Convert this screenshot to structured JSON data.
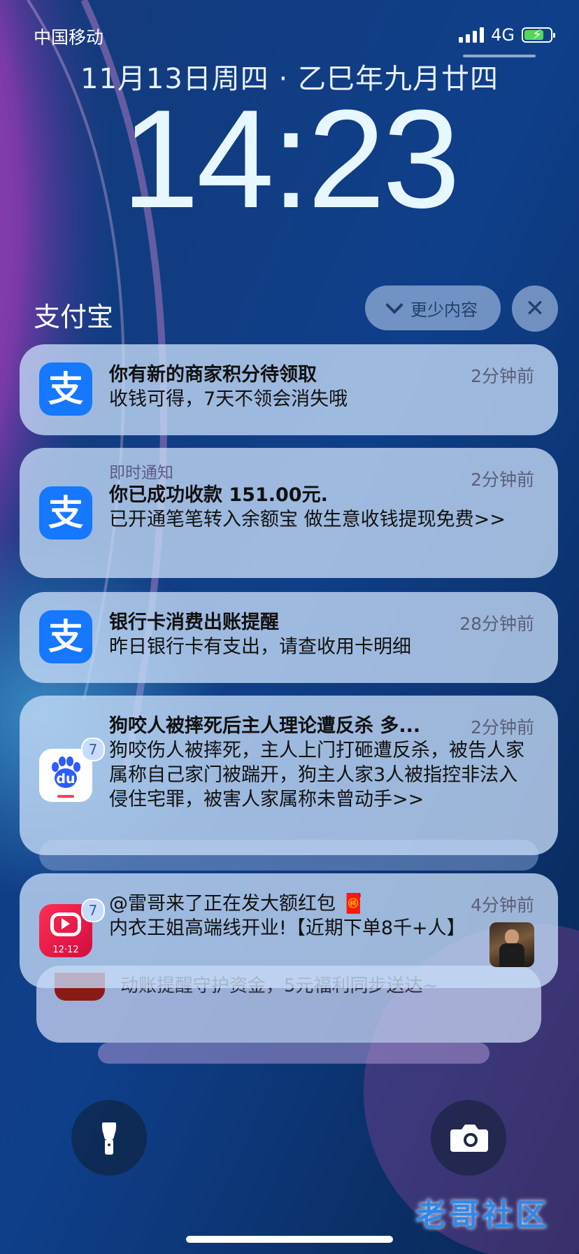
{
  "status_bar": {
    "carrier": "中国移动",
    "network": "4G",
    "signal_bars": 4,
    "battery_level": 0.75,
    "battery_charging": true
  },
  "lock": {
    "date": "11月13日周四 · 乙巳年九月廿四",
    "time": "14:23"
  },
  "group": {
    "app_name": "支付宝",
    "show_less_label": "更少内容",
    "close_glyph": "✕"
  },
  "notifications": [
    {
      "icon": "alipay-icon",
      "icon_glyph": "支",
      "app_label": "",
      "title": "你有新的商家积分待领取",
      "body": "收钱可得，7天不领会消失哦",
      "time": "2分钟前"
    },
    {
      "icon": "alipay-icon",
      "icon_glyph": "支",
      "app_label": "即时通知",
      "title": "你已成功收款 151.00元.",
      "body": "已开通笔笔转入余额宝 做生意收钱提现免费>>",
      "time": "2分钟前"
    },
    {
      "icon": "alipay-icon",
      "icon_glyph": "支",
      "app_label": "",
      "title": "银行卡消费出账提醒",
      "body": "昨日银行卡有支出，请查收用卡明细",
      "time": "28分钟前"
    },
    {
      "icon": "baidu-icon",
      "icon_glyph": "du",
      "badge": "7",
      "app_label": "",
      "title": "狗咬人被摔死后主人理论遭反杀 多...",
      "body": "狗咬伤人被摔死，主人上门打砸遭反杀，被告人家属称自己家门被踹开，狗主人家3人被指控非法入侵住宅罪，被害人家属称未曾动手>>",
      "time": "2分钟前"
    },
    {
      "icon": "video-app-icon",
      "icon_glyph": "12·12",
      "badge": "7",
      "app_label": "",
      "title": "@雷哥来了正在发大额红包 🧧",
      "body": "内衣王姐高端线开业!【近期下单8千+人】",
      "time": "4分钟前"
    }
  ],
  "stacked_behind": {
    "body": "动账提醒守护资金，5元福利同步送达~"
  },
  "watermark": "老哥社区",
  "colors": {
    "accent_alipay": "#1677ff",
    "battery_green": "#55d75b",
    "card_bg": "#c6dcf7"
  }
}
